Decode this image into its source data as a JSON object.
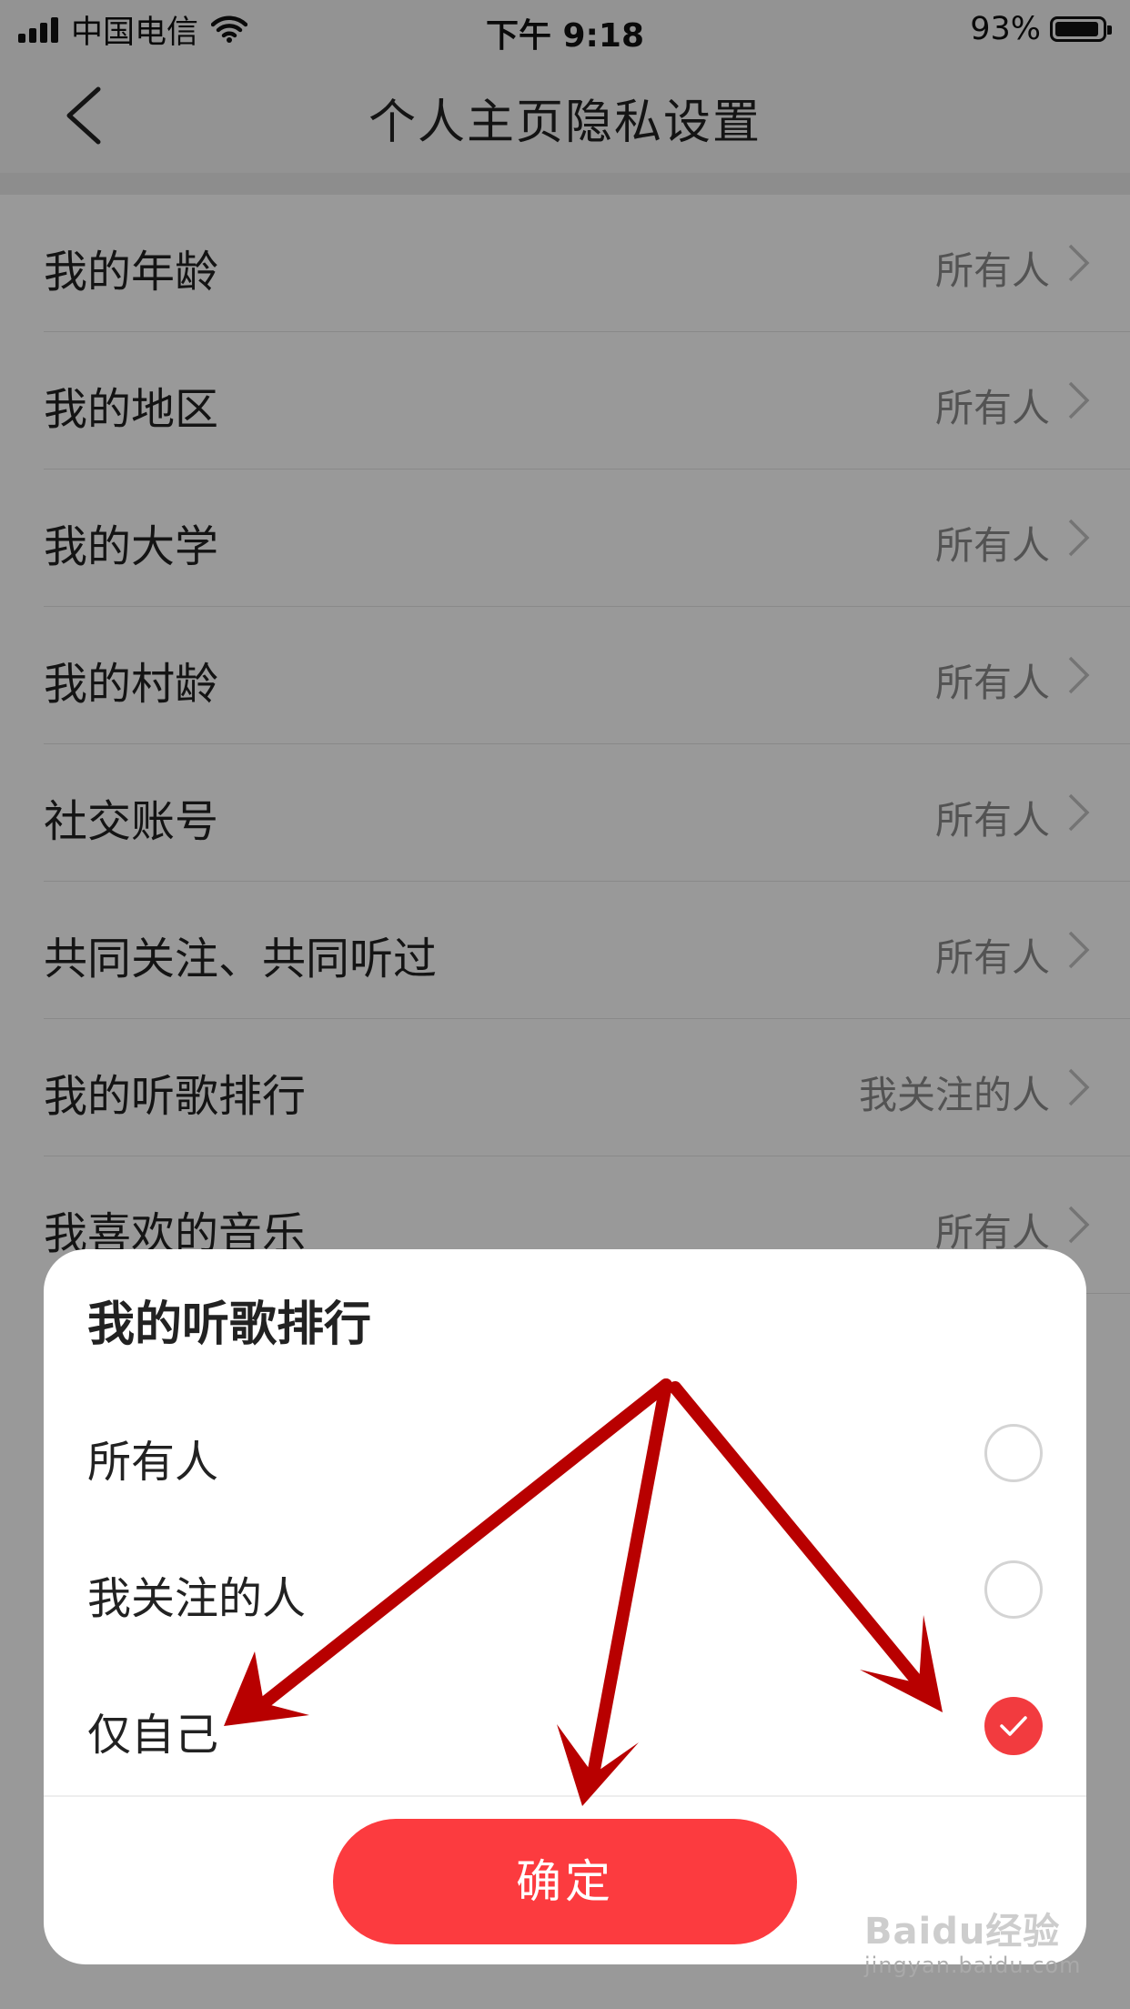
{
  "status_bar": {
    "carrier": "中国电信",
    "time": "下午 9:18",
    "battery": "93%",
    "battery_level": 0.93
  },
  "nav": {
    "title": "个人主页隐私设置"
  },
  "settings": [
    {
      "label": "我的年龄",
      "value": "所有人"
    },
    {
      "label": "我的地区",
      "value": "所有人"
    },
    {
      "label": "我的大学",
      "value": "所有人"
    },
    {
      "label": "我的村龄",
      "value": "所有人"
    },
    {
      "label": "社交账号",
      "value": "所有人"
    },
    {
      "label": "共同关注、共同听过",
      "value": "所有人"
    },
    {
      "label": "我的听歌排行",
      "value": "我关注的人"
    },
    {
      "label": "我喜欢的音乐",
      "value": "所有人"
    }
  ],
  "sheet": {
    "title": "我的听歌排行",
    "options": [
      {
        "label": "所有人",
        "selected": false
      },
      {
        "label": "我关注的人",
        "selected": false
      },
      {
        "label": "仅自己",
        "selected": true
      }
    ],
    "confirm_label": "确定"
  },
  "watermark": {
    "brand": "Baidu经验",
    "url": "jingyan.baidu.com"
  },
  "colors": {
    "accent": "#fc3b3f",
    "annotation_arrow": "#b80000"
  }
}
